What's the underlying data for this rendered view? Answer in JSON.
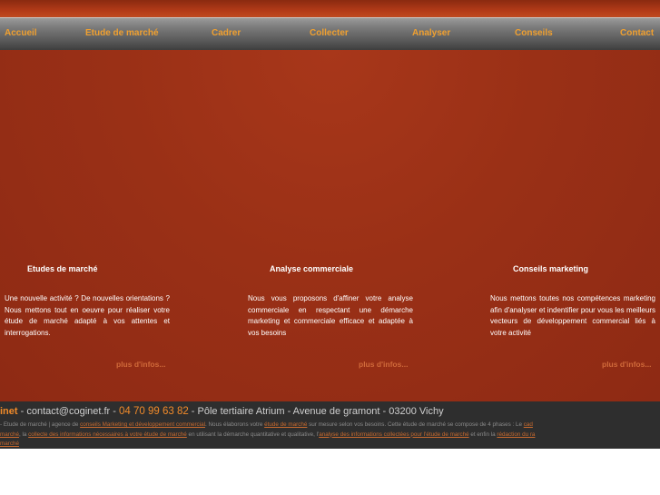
{
  "nav": {
    "items": [
      "Accueil",
      "Etude de marché",
      "Cadrer",
      "Collecter",
      "Analyser",
      "Conseils",
      "Contact"
    ]
  },
  "columns": [
    {
      "title": "Etudes de marché",
      "text": "Une nouvelle activité ? De nouvelles orientations ? Nous mettons tout en oeuvre pour réaliser votre étude de marché adapté à vos attentes et interrogations.",
      "more": "plus d'infos..."
    },
    {
      "title": "Analyse commerciale",
      "text": "Nous vous proposons d'affiner votre analyse commerciale en respectant une démarche marketing et commerciale efficace et adaptée à vos besoins",
      "more": "plus d'infos..."
    },
    {
      "title": "Conseils marketing",
      "text": "Nous mettons toutes nos compétences marketing afin d'analyser et indentifier pour vous les meilleurs vecteurs de développement commercial liés à votre activité",
      "more": "plus d'infos..."
    }
  ],
  "footer": {
    "brand": "inet",
    "contact": " - contact@coginet.fr - ",
    "phone": "04 70 99 63 82",
    "address": " - Pôle tertiaire Atrium - Avenue de gramont - 03200 Vichy",
    "line1_a": "- Etude de marché | agence de ",
    "line1_link1": "conseils Marketing et développement commercial",
    "line1_b": ". Nous élaborons votre ",
    "line1_link2": "étude de marché",
    "line1_c": " sur mesure selon vos besoins. Cette étude de marché se compose de 4 phases : Le ",
    "line1_link3": "cad",
    "line2_link1": "marché",
    "line2_a": ", la ",
    "line2_link2": "collecte des informations nécessaires à votre étude de marché",
    "line2_b": " en utilisant la démarche quantitative et qualitative, l'",
    "line2_link3": "analyse des informations collectées pour l'étude de marché",
    "line2_c": " et enfin la ",
    "line2_link4": "rédaction du ra",
    "line3_link1": "marché"
  }
}
